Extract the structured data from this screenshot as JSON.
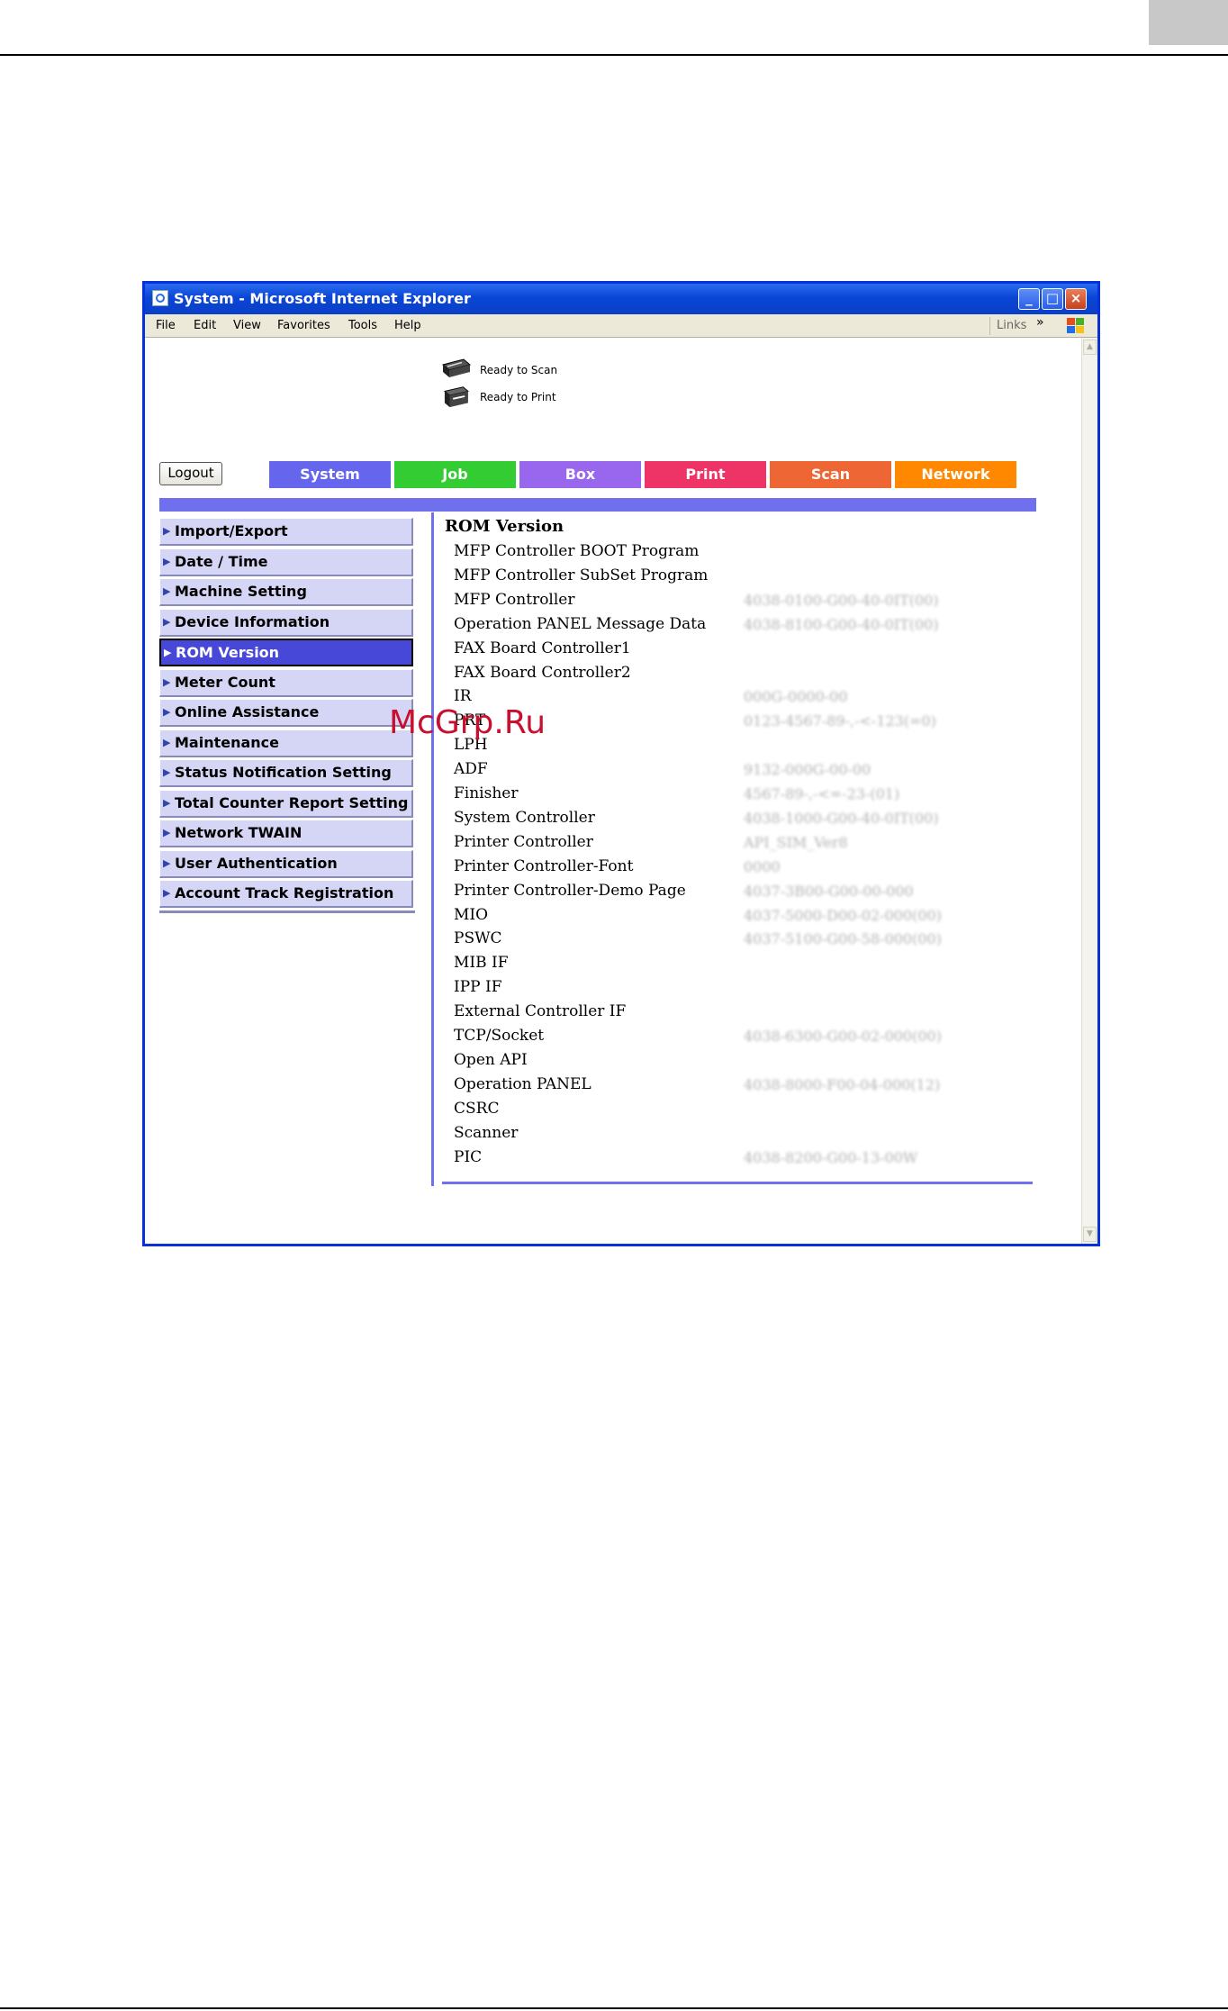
{
  "window": {
    "title": "System - Microsoft Internet Explorer",
    "buttons": {
      "minimize": "_",
      "maximize": "□",
      "close": "×"
    }
  },
  "menubar": {
    "items": [
      {
        "label": "File"
      },
      {
        "label": "Edit"
      },
      {
        "label": "View"
      },
      {
        "label": "Favorites"
      },
      {
        "label": "Tools"
      },
      {
        "label": "Help"
      }
    ],
    "links_label": "Links",
    "links_arrow": "»"
  },
  "status": {
    "scan": "Ready to Scan",
    "print": "Ready to Print"
  },
  "logout_label": "Logout",
  "tabs": [
    {
      "label": "System",
      "color": "#6565ee"
    },
    {
      "label": "Job",
      "color": "#33cc33"
    },
    {
      "label": "Box",
      "color": "#9966ee"
    },
    {
      "label": "Print",
      "color": "#ee3366"
    },
    {
      "label": "Scan",
      "color": "#ee6633"
    },
    {
      "label": "Network",
      "color": "#ff8800"
    }
  ],
  "sidebar": {
    "items": [
      {
        "label": "Import/Export"
      },
      {
        "label": "Date / Time"
      },
      {
        "label": "Machine Setting"
      },
      {
        "label": "Device Information"
      },
      {
        "label": "ROM Version",
        "active": true
      },
      {
        "label": "Meter Count"
      },
      {
        "label": "Online Assistance"
      },
      {
        "label": "Maintenance"
      },
      {
        "label": "Status Notification Setting"
      },
      {
        "label": "Total Counter Report Setting"
      },
      {
        "label": "Network TWAIN"
      },
      {
        "label": "User Authentication"
      },
      {
        "label": "Account Track Registration"
      }
    ]
  },
  "rom": {
    "title": "ROM Version",
    "rows": [
      {
        "label": "MFP Controller BOOT Program",
        "value": ""
      },
      {
        "label": "MFP Controller SubSet Program",
        "value": ""
      },
      {
        "label": "MFP Controller",
        "value": "4038-0100-G00-40-0IT(00)"
      },
      {
        "label": "Operation PANEL Message Data",
        "value": "4038-8100-G00-40-0IT(00)"
      },
      {
        "label": "FAX Board Controller1",
        "value": ""
      },
      {
        "label": "FAX Board Controller2",
        "value": ""
      },
      {
        "label": "IR",
        "value": "000G-0000-00"
      },
      {
        "label": "PRT",
        "value": "0123-4567-89-,-<-123(=0)"
      },
      {
        "label": "LPH",
        "value": ""
      },
      {
        "label": "ADF",
        "value": "9132-000G-00-00"
      },
      {
        "label": "Finisher",
        "value": "4567-89-,-<=-23-(01)"
      },
      {
        "label": "System Controller",
        "value": "4038-1000-G00-40-0IT(00)"
      },
      {
        "label": "Printer Controller",
        "value": "API_SIM_Ver8"
      },
      {
        "label": "Printer Controller-Font",
        "value": "0000"
      },
      {
        "label": "Printer Controller-Demo Page",
        "value": "4037-3B00-G00-00-000"
      },
      {
        "label": "MIO",
        "value": "4037-5000-D00-02-000(00)"
      },
      {
        "label": "PSWC",
        "value": "4037-5100-G00-58-000(00)"
      },
      {
        "label": "MIB IF",
        "value": ""
      },
      {
        "label": "IPP IF",
        "value": ""
      },
      {
        "label": "External Controller IF",
        "value": ""
      },
      {
        "label": "TCP/Socket",
        "value": "4038-6300-G00-02-000(00)"
      },
      {
        "label": "Open API",
        "value": ""
      },
      {
        "label": "Operation PANEL",
        "value": "4038-8000-F00-04-000(12)"
      },
      {
        "label": "CSRC",
        "value": ""
      },
      {
        "label": "Scanner",
        "value": ""
      },
      {
        "label": "PIC",
        "value": "4038-8200-G00-13-00W"
      }
    ]
  },
  "watermark": "McGrp.Ru"
}
